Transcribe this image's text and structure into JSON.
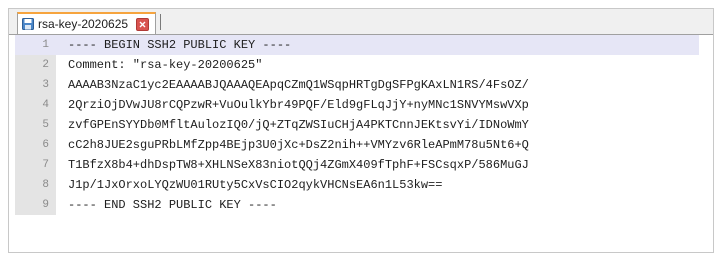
{
  "tab": {
    "title": "rsa-key-2020625",
    "file_icon": "floppy-disk-icon",
    "close_icon": "close-icon"
  },
  "editor": {
    "current_line": 1,
    "lines": [
      {
        "num": "1",
        "text": "---- BEGIN SSH2 PUBLIC KEY ----"
      },
      {
        "num": "2",
        "text": "Comment: \"rsa-key-20200625\""
      },
      {
        "num": "3",
        "text": "AAAAB3NzaC1yc2EAAAABJQAAAQEApqCZmQ1WSqpHRTgDgSFPgKAxLN1RS/4FsOZ/"
      },
      {
        "num": "4",
        "text": "2QrziOjDVwJU8rCQPzwR+VuOulkYbr49PQF/Eld9gFLqJjY+nyMNc1SNVYMswVXp"
      },
      {
        "num": "5",
        "text": "zvfGPEnSYYDb0MfltAulozIQ0/jQ+ZTqZWSIuCHjA4PKTCnnJEKtsvYi/IDNoWmY"
      },
      {
        "num": "6",
        "text": "cC2h8JUE2sguPRbLMfZpp4BEjp3U0jXc+DsZ2nih++VMYzv6RleAPmM78u5Nt6+Q"
      },
      {
        "num": "7",
        "text": "T1BfzX8b4+dhDspTW8+XHLNSeX83niotQQj4ZGmX409fTphF+FSCsqxP/586MuGJ"
      },
      {
        "num": "8",
        "text": "J1p/1JxOrxoLYQzWU01RUty5CxVsCIO2qykVHCNsEA6n1L53kw=="
      },
      {
        "num": "9",
        "text": "---- END SSH2 PUBLIC KEY ----"
      }
    ]
  },
  "colors": {
    "current_line": "#e6e6f6",
    "gutter": "#e4e4e4",
    "tab_accent": "#f6a43e",
    "close_button": "#d9534f"
  }
}
